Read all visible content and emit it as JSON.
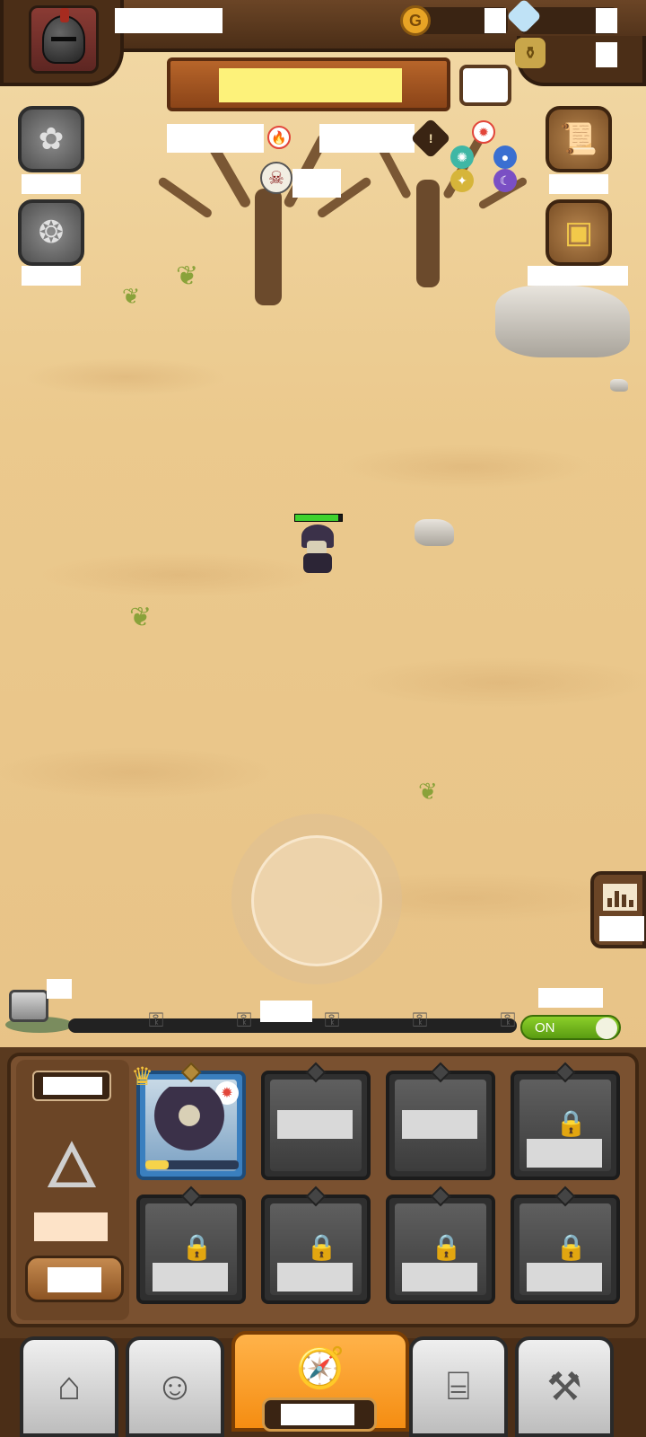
{
  "header": {
    "player_name": "",
    "gold": "",
    "gems": "",
    "potions": "",
    "stage_banner": "",
    "stage_box": ""
  },
  "left_buttons": [
    {
      "icon": "clover-medal-icon",
      "label": ""
    },
    {
      "icon": "laurel-medal-icon",
      "label": ""
    }
  ],
  "right_buttons": [
    {
      "icon": "scroll-icon",
      "label": ""
    },
    {
      "icon": "treasure-chest-icon",
      "label": ""
    }
  ],
  "map_labels": {
    "fire_enemy": "",
    "warning_zone": "",
    "boss_skull": ""
  },
  "hero": {
    "hp_fraction": 0.92
  },
  "stage_progress": {
    "fraction": 0.0,
    "label": "",
    "chest_label": "",
    "keys": 5
  },
  "auto": {
    "label": "",
    "toggle_text": "ON"
  },
  "stats_button": {
    "label": ""
  },
  "team_panel": {
    "level": "",
    "power": "",
    "upgrade": "",
    "slots": [
      {
        "state": "active",
        "label": "",
        "xp_fraction": 0.25
      },
      {
        "state": "empty",
        "label": ""
      },
      {
        "state": "empty",
        "label": ""
      },
      {
        "state": "locked",
        "label": ""
      },
      {
        "state": "locked",
        "label": ""
      },
      {
        "state": "locked",
        "label": ""
      },
      {
        "state": "locked",
        "label": ""
      },
      {
        "state": "locked",
        "label": ""
      }
    ]
  },
  "nav": {
    "items": [
      {
        "icon": "shop-icon"
      },
      {
        "icon": "hero-icon"
      },
      {
        "icon": "adventure-map-icon",
        "label": ""
      },
      {
        "icon": "inventory-bag-icon"
      },
      {
        "icon": "forge-hammer-icon"
      }
    ]
  },
  "colors": {
    "sand": "#ebc98d",
    "wood": "#5a3a1f",
    "toggle_on": "#6bb01c",
    "active_tab": "#f58d12"
  }
}
